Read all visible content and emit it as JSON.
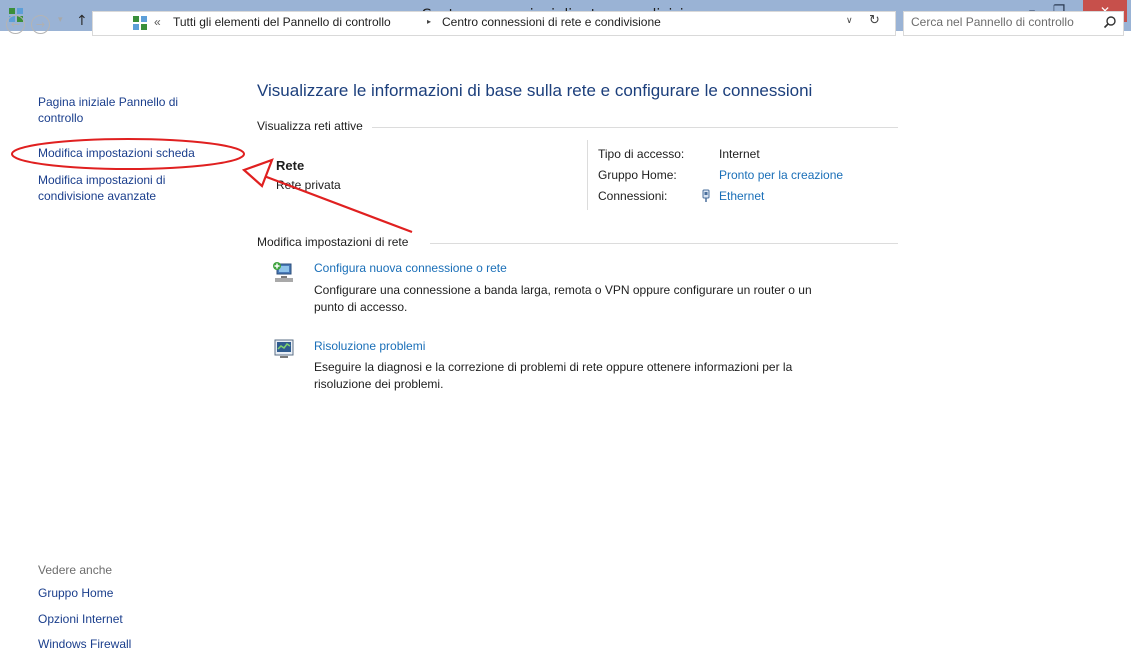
{
  "window": {
    "title": "Centro connessioni di rete e condivisione",
    "minimize_glyph": "–",
    "maximize_glyph": "❐",
    "close_glyph": "✕"
  },
  "nav": {
    "back_glyph": "←",
    "forward_glyph": "→",
    "history_glyph": "▾",
    "up_glyph": "↑"
  },
  "address": {
    "overflow": "«",
    "crumbs": [
      "Tutti gli elementi del Pannello di controllo",
      "Centro connessioni di rete e condivisione"
    ],
    "separator_glyph": "▸",
    "dropdown_glyph": "∨",
    "refresh_glyph": "↻"
  },
  "search": {
    "placeholder": "Cerca nel Pannello di controllo"
  },
  "sidebar": {
    "home_link": [
      "Pagina iniziale Pannello di",
      "controllo"
    ],
    "change_adapter": "Modifica impostazioni scheda",
    "advanced_sharing": [
      "Modifica impostazioni di",
      "condivisione avanzate"
    ],
    "see_also_title": "Vedere anche",
    "see_also": [
      "Gruppo Home",
      "Opzioni Internet",
      "Windows Firewall"
    ]
  },
  "main": {
    "title": "Visualizzare le informazioni di base sulla rete e configurare le connessioni",
    "active_networks_heading": "Visualizza reti attive",
    "network": {
      "name": "Rete",
      "category": "Rete privata",
      "access_type_label": "Tipo di accesso:",
      "access_type_value": "Internet",
      "homegroup_label": "Gruppo Home:",
      "homegroup_value": "Pronto per la creazione",
      "connections_label": "Connessioni:",
      "connections_value": "Ethernet"
    },
    "change_settings_heading": "Modifica impostazioni di rete",
    "tasks": [
      {
        "title": "Configura nuova connessione o rete",
        "description_lines": [
          "Configurare una connessione a banda larga, remota o VPN oppure configurare un router o un",
          "punto di accesso."
        ]
      },
      {
        "title": "Risoluzione problemi",
        "description_lines": [
          "Eseguire la diagnosi e la correzione di problemi di rete oppure ottenere informazioni per la",
          "risoluzione dei problemi."
        ]
      }
    ]
  },
  "colors": {
    "titlebar": "#9ab3d5",
    "close_button": "#c7504b",
    "link": "#1a6fb8",
    "sidebar_link": "#1a3e8c",
    "annotation": "#e02020"
  }
}
